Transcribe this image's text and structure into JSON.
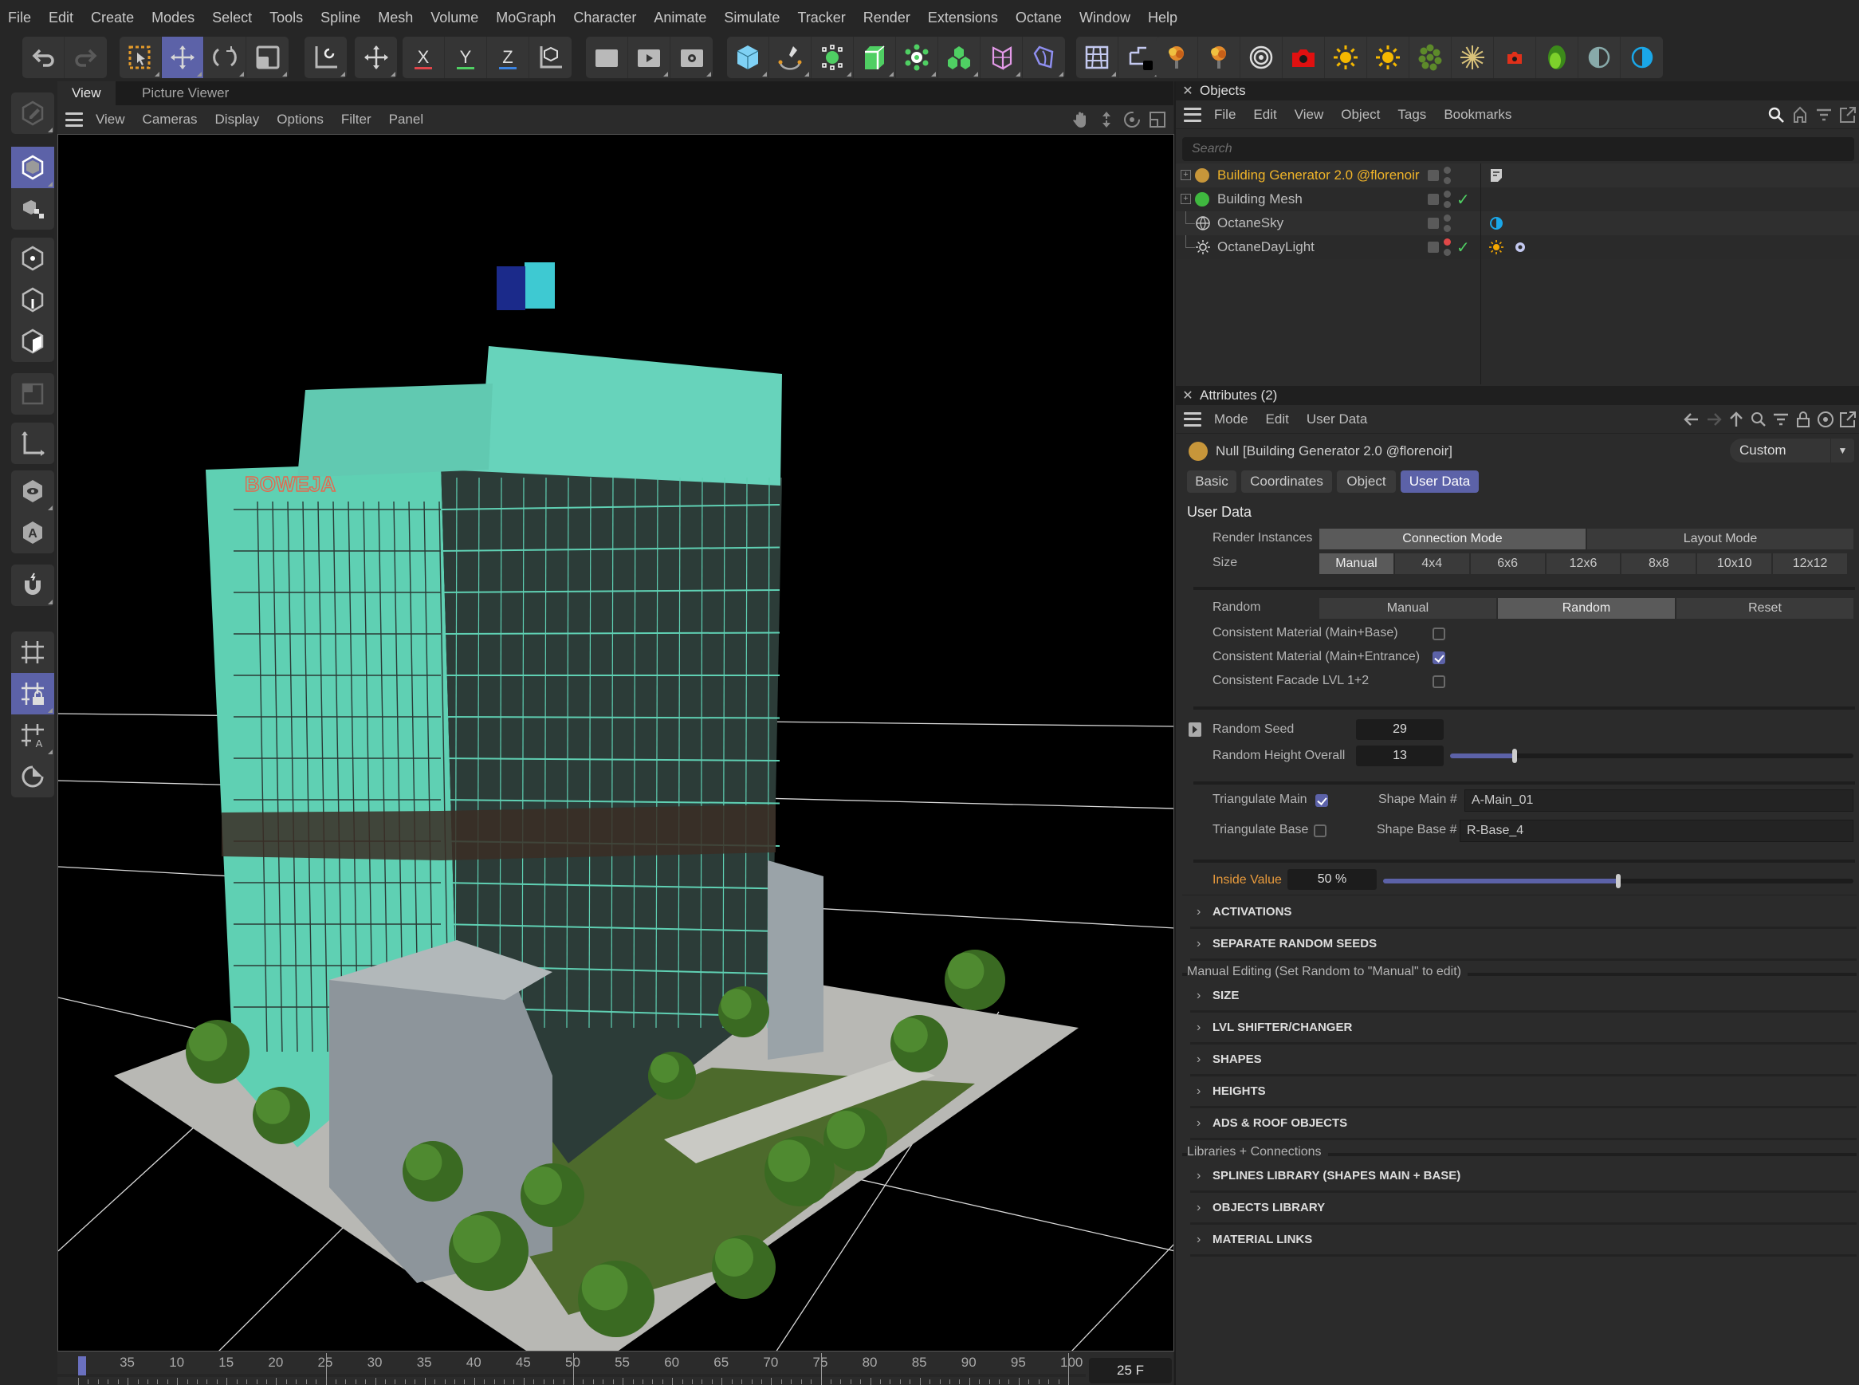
{
  "menubar": [
    "File",
    "Edit",
    "Create",
    "Modes",
    "Select",
    "Tools",
    "Spline",
    "Mesh",
    "Volume",
    "MoGraph",
    "Character",
    "Animate",
    "Simulate",
    "Tracker",
    "Render",
    "Extensions",
    "Octane",
    "Window",
    "Help"
  ],
  "toolbar": {
    "groups": [
      {
        "items": [
          {
            "icon": "undo-icon"
          },
          {
            "icon": "redo-icon"
          }
        ]
      },
      {
        "items": [
          {
            "icon": "live-selection-icon"
          },
          {
            "icon": "move-icon",
            "active": true
          },
          {
            "icon": "rotate-icon"
          },
          {
            "icon": "scale-icon"
          }
        ]
      },
      {
        "items": [
          {
            "icon": "transform-icon"
          }
        ]
      },
      {
        "items": [
          {
            "icon": "move-axis-icon"
          }
        ]
      },
      {
        "items": [
          {
            "icon": "x-axis-icon",
            "label": "X",
            "color": "#e0454a"
          },
          {
            "icon": "y-axis-icon",
            "label": "Y",
            "color": "#4fcf63"
          },
          {
            "icon": "z-axis-icon",
            "label": "Z",
            "color": "#3b83e0"
          },
          {
            "icon": "coordinate-system-icon"
          }
        ]
      },
      {
        "items": [
          {
            "icon": "render-view-icon"
          },
          {
            "icon": "render-picture-viewer-icon"
          },
          {
            "icon": "render-settings-icon"
          }
        ]
      },
      {
        "items": [
          {
            "icon": "cube-icon"
          },
          {
            "icon": "pen-spline-icon"
          },
          {
            "icon": "subdivision-icon"
          },
          {
            "icon": "extrude-icon"
          },
          {
            "icon": "cloner-icon"
          },
          {
            "icon": "mograph-icon"
          },
          {
            "icon": "deformer-icon"
          },
          {
            "icon": "field-icon"
          }
        ]
      },
      {
        "items": [
          {
            "icon": "floor-grid-icon"
          },
          {
            "icon": "camera-st-icon"
          }
        ]
      },
      {
        "items": [
          {
            "icon": "octane-explosion-icon"
          },
          {
            "icon": "octane-explosion2-icon"
          },
          {
            "icon": "octane-target-icon"
          },
          {
            "icon": "octane-camera-icon"
          },
          {
            "icon": "octane-sun-icon"
          },
          {
            "icon": "octane-daylight-icon"
          },
          {
            "icon": "octane-scatter-icon"
          },
          {
            "icon": "octane-light-burst-icon"
          },
          {
            "icon": "octane-small-camera-icon"
          },
          {
            "icon": "octane-live-viewer-icon"
          },
          {
            "icon": "octane-sky-grey-icon"
          },
          {
            "icon": "octane-sky-blue-icon"
          }
        ]
      }
    ]
  },
  "left_toolbar": [
    {
      "icon": "edit-mode-icon",
      "dim": true
    },
    {
      "icon": "model-mode-icon",
      "active": true
    },
    {
      "icon": "texture-mode-icon"
    },
    {
      "icon": "points-mode-icon"
    },
    {
      "icon": "edges-mode-icon"
    },
    {
      "icon": "polygons-mode-icon"
    },
    {
      "icon": "uv-mode-icon",
      "dim": true
    },
    {
      "icon": "axis-mode-icon"
    },
    {
      "icon": "solo-view-icon"
    },
    {
      "icon": "auto-solo-icon"
    },
    {
      "icon": "snap-magnet-icon"
    },
    {
      "icon": "workplane-icon"
    },
    {
      "icon": "lock-workplane-icon",
      "active": true
    },
    {
      "icon": "align-workplane-icon"
    },
    {
      "icon": "rotate-workplane-icon"
    }
  ],
  "viewport": {
    "tabs": [
      {
        "label": "View",
        "active": true
      },
      {
        "label": "Picture Viewer",
        "active": false
      }
    ],
    "menu": [
      "View",
      "Cameras",
      "Display",
      "Options",
      "Filter",
      "Panel"
    ],
    "nav_icons": [
      "pan-hand-icon",
      "dolly-icon",
      "orbit-icon",
      "maximize-view-icon"
    ],
    "scene_sign_text": "BOWEJA"
  },
  "timeline": {
    "ticks": [
      "35",
      "10",
      "15",
      "20",
      "25",
      "30",
      "35",
      "40",
      "45",
      "50",
      "55",
      "60",
      "65",
      "70",
      "75",
      "80",
      "85",
      "90",
      "95",
      "100"
    ],
    "current_frame": "25 F",
    "start_value": 0,
    "playhead_value": 25,
    "max_value": 100
  },
  "objects_panel": {
    "title": "Objects",
    "menu": [
      "File",
      "Edit",
      "View",
      "Object",
      "Tags",
      "Bookmarks"
    ],
    "search_placeholder": "Search",
    "items": [
      {
        "name": "Building Generator 2.0 @florenoir",
        "icon": "null-object-icon",
        "icon_color": "#c7963a",
        "highlight": true,
        "expandable": true,
        "check": false,
        "tags": [
          "annotation-tag-icon"
        ]
      },
      {
        "name": "Building Mesh",
        "icon": "null-object-icon",
        "icon_color": "#3fb83f",
        "highlight": false,
        "expandable": true,
        "check": true,
        "tags": []
      },
      {
        "name": "OctaneSky",
        "icon": "sky-icon",
        "highlight": false,
        "expandable": false,
        "check": false,
        "tags": [
          "octane-environment-tag-icon"
        ]
      },
      {
        "name": "OctaneDayLight",
        "icon": "daylight-icon",
        "highlight": false,
        "expandable": false,
        "check": true,
        "red_dot": true,
        "tags": [
          "octane-daylight-tag-icon",
          "octane-object-tag-icon"
        ]
      }
    ]
  },
  "attributes_panel": {
    "title": "Attributes (2)",
    "menu": [
      "Mode",
      "Edit",
      "User Data"
    ],
    "object_name": "Null [Building Generator 2.0 @florenoir]",
    "preset": "Custom",
    "tabs": [
      {
        "label": "Basic",
        "active": false
      },
      {
        "label": "Coordinates",
        "active": false
      },
      {
        "label": "Object",
        "active": false
      },
      {
        "label": "User Data",
        "active": true
      }
    ],
    "section_title": "User Data",
    "render_instances": {
      "label": "Render Instances",
      "options": [
        "Connection Mode",
        "Layout Mode"
      ],
      "selected": 0
    },
    "size": {
      "label": "Size",
      "options": [
        "Manual",
        "4x4",
        "6x6",
        "12x6",
        "8x8",
        "10x10",
        "12x12"
      ],
      "selected": 0
    },
    "random": {
      "label": "Random",
      "options": [
        "Manual",
        "Random",
        "Reset"
      ],
      "selected": 1
    },
    "checkboxes": [
      {
        "label": "Consistent Material (Main+Base)",
        "checked": false
      },
      {
        "label": "Consistent Material (Main+Entrance)",
        "checked": true
      },
      {
        "label": "Consistent Facade LVL 1+2",
        "checked": false
      }
    ],
    "random_seed": {
      "label": "Random Seed",
      "value": "29"
    },
    "random_height": {
      "label": "Random Height Overall",
      "value": "13",
      "slider_fraction": 0.16
    },
    "triangulate_main": {
      "label": "Triangulate Main",
      "checked": true
    },
    "triangulate_base": {
      "label": "Triangulate Base",
      "checked": false
    },
    "shape_main": {
      "label": "Shape Main #",
      "value": "A-Main_01"
    },
    "shape_base": {
      "label": "Shape Base #",
      "value": "R-Base_4"
    },
    "inside_value": {
      "label": "Inside Value",
      "value": "50 %",
      "slider_fraction": 0.5,
      "label_color": "#e79a3c"
    },
    "groups_a": [
      "ACTIVATIONS",
      "SEPARATE RANDOM SEEDS"
    ],
    "manual_editing_label": "Manual Editing (Set Random to \"Manual\" to edit)",
    "groups_b": [
      "SIZE",
      "LVL SHIFTER/CHANGER",
      "SHAPES",
      "HEIGHTS",
      "ADS & ROOF OBJECTS"
    ],
    "libraries_label": "Libraries + Connections",
    "groups_c": [
      "SPLINES LIBRARY (SHAPES MAIN + BASE)",
      "OBJECTS LIBRARY",
      "MATERIAL LINKS"
    ]
  },
  "colors": {
    "accent": "#5c62a8",
    "highlight_text": "#f0b429",
    "bg": "#262626",
    "panel": "#2b2b2b"
  }
}
